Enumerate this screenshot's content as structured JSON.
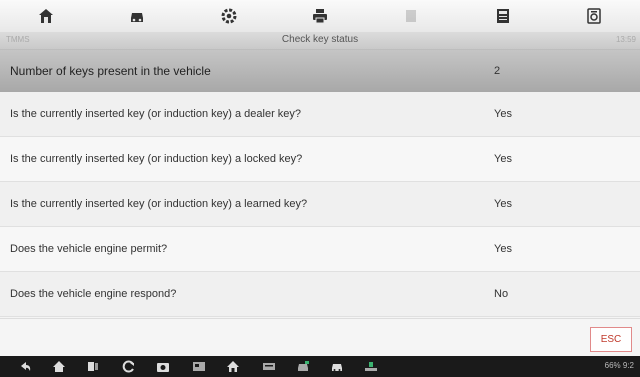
{
  "toolbar": {
    "buttons": [
      "home-icon",
      "vehicle-icon",
      "settings-icon",
      "print-icon",
      "help-icon",
      "save-icon",
      "data-logging-icon"
    ]
  },
  "titlebar": {
    "left_label": "TMMS",
    "title": "Check key status",
    "right_label": "13:59"
  },
  "rows": [
    {
      "question": "Number of keys present in the vehicle",
      "value": "2"
    },
    {
      "question": "Is the currently inserted key (or induction key) a dealer key?",
      "value": "Yes"
    },
    {
      "question": "Is the currently inserted key (or induction key) a locked key?",
      "value": "Yes"
    },
    {
      "question": "Is the currently inserted key (or induction key) a learned key?",
      "value": "Yes"
    },
    {
      "question": "Does the vehicle engine permit?",
      "value": "Yes"
    },
    {
      "question": "Does the vehicle engine respond?",
      "value": "No"
    }
  ],
  "footer": {
    "esc_label": "ESC"
  },
  "navbar": {
    "buttons": [
      "back-icon",
      "home-icon",
      "recent-apps-icon",
      "refresh-icon",
      "camera-icon",
      "screenshot-icon",
      "app-home-icon",
      "vci-icon",
      "vehicle-nav-icon",
      "car-nav-icon",
      "network-icon"
    ],
    "status": "66% 9:2"
  },
  "colors": {
    "accent": "#c0392b",
    "highlight": "#b5b5b5",
    "navbar": "#1a1a1a"
  }
}
